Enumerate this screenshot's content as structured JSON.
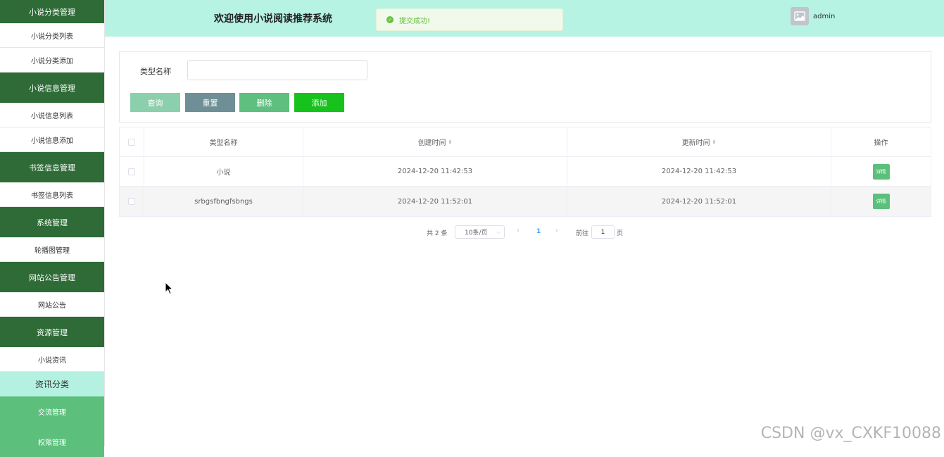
{
  "sidebar": {
    "items": [
      {
        "label": "小说分类管理",
        "type": "group"
      },
      {
        "label": "小说分类列表",
        "type": "sub"
      },
      {
        "label": "小说分类添加",
        "type": "sub"
      },
      {
        "label": "小说信息管理",
        "type": "group"
      },
      {
        "label": "小说信息列表",
        "type": "sub"
      },
      {
        "label": "小说信息添加",
        "type": "sub"
      },
      {
        "label": "书签信息管理",
        "type": "group"
      },
      {
        "label": "书签信息列表",
        "type": "sub"
      },
      {
        "label": "系统管理",
        "type": "group"
      },
      {
        "label": "轮播图管理",
        "type": "sub"
      },
      {
        "label": "网站公告管理",
        "type": "group"
      },
      {
        "label": "网站公告",
        "type": "sub"
      },
      {
        "label": "资源管理",
        "type": "group"
      },
      {
        "label": "小说资讯",
        "type": "sub"
      },
      {
        "label": "资讯分类",
        "type": "active"
      },
      {
        "label": "交流管理",
        "type": "light"
      },
      {
        "label": "权限管理",
        "type": "light"
      }
    ]
  },
  "header": {
    "title": "欢迎使用小说阅读推荐系统",
    "toast": "提交成功!",
    "user": "admin"
  },
  "search": {
    "label": "类型名称",
    "value": "",
    "buttons": {
      "query": "查询",
      "reset": "重置",
      "delete": "删除",
      "add": "添加"
    }
  },
  "table": {
    "headers": [
      "类型名称",
      "创建时间",
      "更新时间",
      "操作"
    ],
    "rows": [
      {
        "name": "小说",
        "created": "2024-12-20 11:42:53",
        "updated": "2024-12-20 11:42:53",
        "action": "详情"
      },
      {
        "name": "srbgsfbngfsbngs",
        "created": "2024-12-20 11:52:01",
        "updated": "2024-12-20 11:52:01",
        "action": "详情"
      }
    ]
  },
  "pagination": {
    "total": "共 2 条",
    "page_size": "10条/页",
    "current": "1",
    "goto_prefix": "前往",
    "goto_value": "1",
    "goto_suffix": "页"
  },
  "watermark": "CSDN @vx_CXKF10088",
  "colors": {
    "sidebar_group": "#2e6b36",
    "header_bg": "#b6f3e3",
    "accent_green": "#5cbf7c",
    "btn_query": "#8ccfad",
    "btn_reset": "#6e8f96",
    "btn_delete": "#5fbf7f",
    "btn_add": "#18c21c"
  }
}
